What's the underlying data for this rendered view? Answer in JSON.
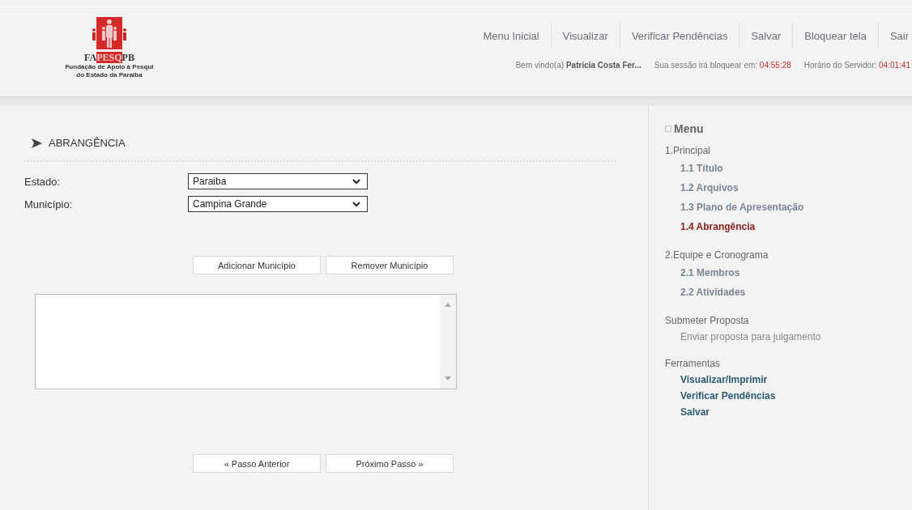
{
  "logo": {
    "mark_left": "FA",
    "mark_highlight": "PESQ",
    "mark_right": "PB",
    "caption_line_1": "Fundação de Apoio à Pesqui",
    "caption_line_2": "do Estado da Paraiba"
  },
  "nav": [
    "Menu Inicial",
    "Visualizar",
    "Verificar Pendências",
    "Salvar",
    "Bloquear tela",
    "Sair"
  ],
  "status": {
    "welcome_label": "Bem vindo(a)",
    "user_name": "Patricia Costa Fer...",
    "session_label": "Sua sessão irá bloquear em:",
    "session_time": "04:55:28",
    "server_label": "Horário do Servidor:",
    "server_time": "04:01:41"
  },
  "section": {
    "title": "ABRANGÊNCIA"
  },
  "form": [
    {
      "label": "Estado:",
      "value": "Paraiba"
    },
    {
      "label": "Município:",
      "value": "Campina Grande"
    }
  ],
  "list_buttons": [
    "Adicionar Município",
    "Remover Município"
  ],
  "step_buttons": [
    "« Passo Anterior",
    "Próximo Passo »"
  ],
  "menu": {
    "title": "Menu",
    "groups": [
      {
        "title": "1.Principal",
        "items": [
          {
            "label": "1.1 Título",
            "kind": "step",
            "selected": false
          },
          {
            "label": "1.2 Arquivos",
            "kind": "step",
            "selected": false
          },
          {
            "label": "1.3 Plano de Apresentação",
            "kind": "step",
            "selected": false
          },
          {
            "label": "1.4 Abrangência",
            "kind": "step",
            "selected": true
          }
        ]
      },
      {
        "title": "2.Equipe e Cronograma",
        "items": [
          {
            "label": "2.1 Membros",
            "kind": "step",
            "selected": false
          },
          {
            "label": "2.2 Atividades",
            "kind": "step",
            "selected": false
          }
        ]
      },
      {
        "title": "Submeter Proposta",
        "items": [
          {
            "label": "Enviar proposta para julgamento",
            "kind": "action",
            "selected": false
          }
        ]
      },
      {
        "title": "Ferramentas",
        "items": [
          {
            "label": "Visualizar/Imprimir",
            "kind": "tool",
            "selected": false
          },
          {
            "label": "Verificar Pendências",
            "kind": "tool",
            "selected": false
          },
          {
            "label": "Salvar",
            "kind": "tool",
            "selected": false
          }
        ]
      }
    ]
  }
}
